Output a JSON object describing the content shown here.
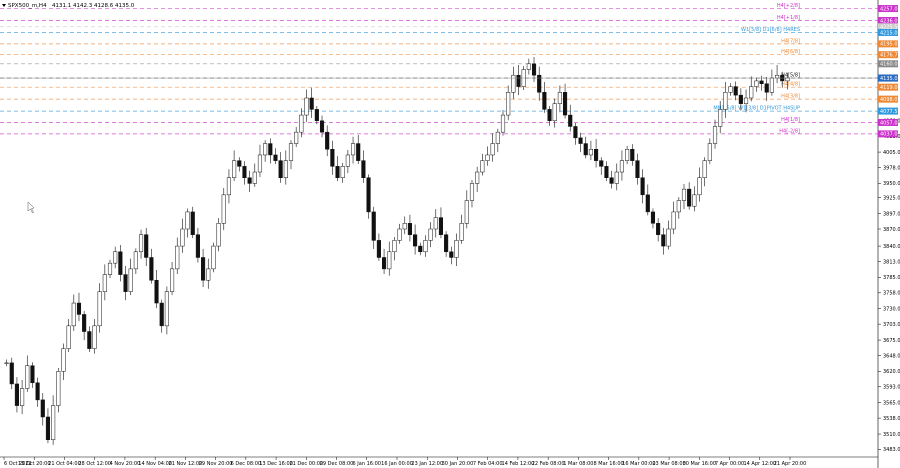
{
  "header": {
    "symbol": "SPX500_m,H4",
    "ohlc": "4131.1 4142.3 4128.6 4135.0"
  },
  "chart_data": {
    "type": "candlestick",
    "title": "",
    "ylim": [
      3475,
      4265
    ],
    "y_ticks": [
      "3925.0",
      "3897.0",
      "3870.0",
      "3840.0",
      "3813.0",
      "3785.0",
      "3758.0",
      "3730.0",
      "3703.0",
      "3675.0",
      "3648.0",
      "3620.0",
      "3593.0",
      "3565.0",
      "3538.0",
      "3510.0",
      "3483.0",
      "4005.0",
      "3978.0",
      "3950.0",
      "4060.0",
      "4033.0"
    ],
    "x_ticks": [
      "6 Oct 2022",
      "13 Oct 20:00",
      "21 Oct 04:00",
      "28 Oct 12:00",
      "4 Nov 20:00",
      "14 Nov 04:00",
      "21 Nov 12:00",
      "29 Nov 20:00",
      "6 Dec 08:00",
      "13 Dec 16:00",
      "21 Dec 00:00",
      "29 Dec 08:00",
      "6 Jan 16:00",
      "16 Jan 00:00",
      "23 Jan 12:00",
      "30 Jan 20:00",
      "7 Feb 04:00",
      "14 Feb 12:00",
      "22 Feb 08:00",
      "1 Mar 08:00",
      "8 Mar 16:00",
      "16 Mar 00:00",
      "23 Mar 08:00",
      "30 Mar 16:00",
      "7 Apr 00:00",
      "14 Apr 12:00",
      "21 Apr 20:00"
    ],
    "series": [
      {
        "values": [
          3635,
          3598,
          3560,
          3590,
          3630,
          3600,
          3570,
          3540,
          3500,
          3560,
          3620,
          3660,
          3700,
          3740,
          3720,
          3690,
          3660,
          3700,
          3760,
          3790,
          3810,
          3830,
          3790,
          3760,
          3800,
          3830,
          3860,
          3820,
          3780,
          3740,
          3700,
          3760,
          3800,
          3840,
          3870,
          3900,
          3860,
          3820,
          3780,
          3800,
          3840,
          3880,
          3930,
          3960,
          3990,
          3980,
          3960,
          3950,
          3970,
          4000,
          4020,
          4000,
          3990,
          3960,
          3990,
          4020,
          4040,
          4070,
          4100,
          4080,
          4060,
          4040,
          4010,
          3980,
          3960,
          3980,
          4000,
          4020,
          3990,
          3960,
          3900,
          3850,
          3820,
          3800,
          3830,
          3850,
          3870,
          3880,
          3860,
          3840,
          3830,
          3850,
          3870,
          3890,
          3860,
          3830,
          3820,
          3850,
          3880,
          3920,
          3950,
          3970,
          3990,
          4000,
          4020,
          4040,
          4070,
          4110,
          4140,
          4120,
          4150,
          4160,
          4140,
          4110,
          4080,
          4060,
          4090,
          4110,
          4070,
          4050,
          4030,
          4020,
          4000,
          4010,
          3990,
          3980,
          3960,
          3950,
          3970,
          3990,
          4010,
          3990,
          3960,
          3930,
          3900,
          3880,
          3860,
          3840,
          3870,
          3900,
          3920,
          3940,
          3910,
          3930,
          3960,
          3990,
          4020,
          4050,
          4080,
          4110,
          4120,
          4105,
          4090,
          4100,
          4120,
          4130,
          4125,
          4110,
          4135,
          4140,
          4130,
          4135
        ]
      }
    ],
    "levels": [
      {
        "label": "H4[+2/8]",
        "price": 4257.0,
        "color": "#cc33cc",
        "tag": "4257.0"
      },
      {
        "label": "H4[+1/8]",
        "price": 4236.0,
        "color": "#cc33cc",
        "tag": "4236.0"
      },
      {
        "label": "",
        "price": 4225.0,
        "color": "#cccccc",
        "tag": "4225.5"
      },
      {
        "label": "W1[5/8] D1[6/8] H4RES",
        "price": 4215.0,
        "color": "#3399dd",
        "tag": "4215.0"
      },
      {
        "label": "H4[7/8]",
        "price": 4195.0,
        "color": "#ee8833",
        "tag": "4195.0"
      },
      {
        "label": "H4[6/8]",
        "price": 4176.0,
        "color": "#ee8833",
        "tag": "4176.7"
      },
      {
        "label": "",
        "price": 4160.0,
        "color": "#888888",
        "tag": "4160.0"
      },
      {
        "label": "H4[5/8]",
        "price": 4135.0,
        "color": "#222222",
        "tag": "4135.0"
      },
      {
        "label": "H4[4/8]",
        "price": 4119.0,
        "color": "#ee8833",
        "tag": "4119.0"
      },
      {
        "label": "H4[3/8]",
        "price": 4098.0,
        "color": "#ee8833",
        "tag": "4098.0"
      },
      {
        "label": "MN1[5/8] W1[3/8] D1PIVOT H4SUP",
        "price": 4077.0,
        "color": "#3399dd",
        "tag": "4077.5"
      },
      {
        "label": "H4[1/8]",
        "price": 4057.0,
        "color": "#cc33cc",
        "tag": "4057.0"
      },
      {
        "label": "H4[-2/8]",
        "price": 4037.0,
        "color": "#cc33cc",
        "tag": "4037.0"
      }
    ],
    "current_price": "4135.0"
  }
}
